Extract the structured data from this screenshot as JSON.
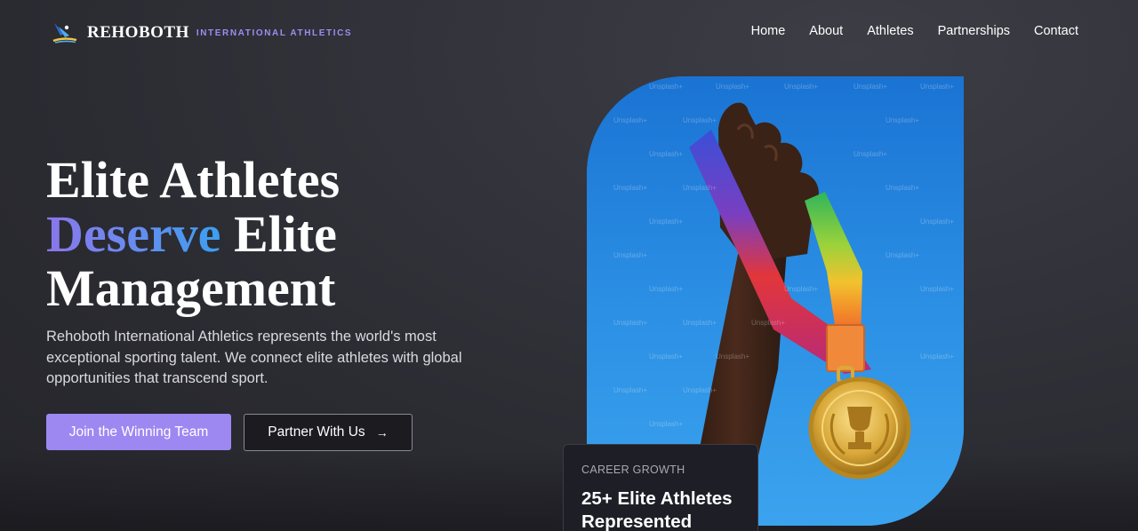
{
  "brand": {
    "name": "REHOBOTH",
    "tagline": "INTERNATIONAL ATHLETICS",
    "logo_icon": "runner-logo-icon"
  },
  "nav": {
    "items": [
      {
        "label": "Home"
      },
      {
        "label": "About"
      },
      {
        "label": "Athletes"
      },
      {
        "label": "Partnerships"
      },
      {
        "label": "Contact"
      }
    ]
  },
  "hero": {
    "title_line1": "Elite Athletes",
    "title_accent": "Deserve",
    "title_line2_rest": " Elite",
    "title_line3": "Management",
    "description": "Rehoboth International Athletics represents the world's most exceptional sporting talent. We connect elite athletes with global opportunities that transcend sport.",
    "primary_cta": "Join the Winning Team",
    "secondary_cta": "Partner With Us",
    "secondary_cta_icon": "arrow-right-icon",
    "image_watermark": "Unsplash+"
  },
  "stat_card": {
    "label": "CAREER GROWTH",
    "value_line1": "25+ Elite Athletes",
    "value_line2": "Represented"
  },
  "colors": {
    "accent": "#9d88f2",
    "background": "#2f2f36",
    "card": "#1e1f26"
  }
}
